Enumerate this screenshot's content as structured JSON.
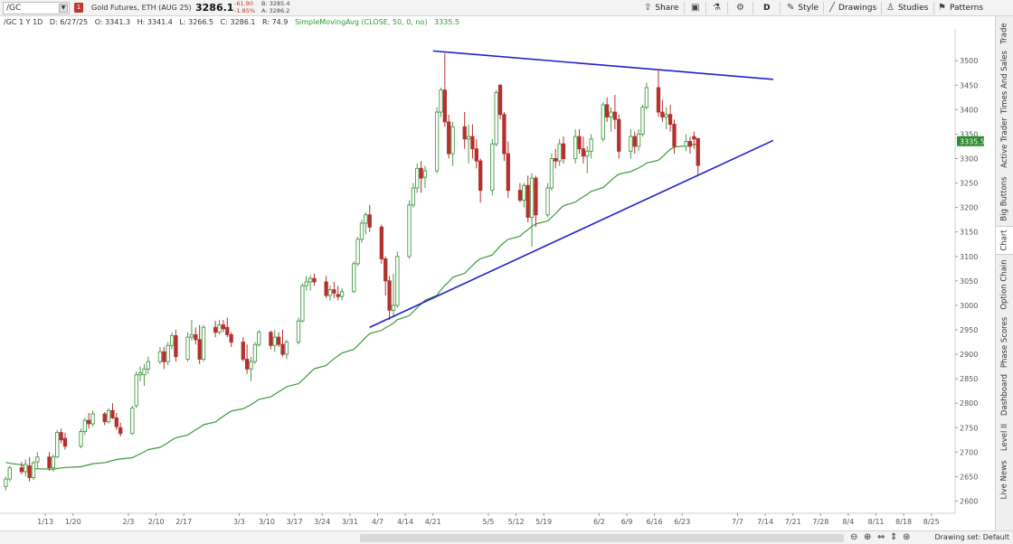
{
  "toolbar": {
    "symbol": "/GC",
    "alert_badge": "1",
    "instrument": "Gold Futures, ETH (AUG 25)",
    "last_price": "3286.1",
    "change": "-61.90",
    "change_pct": "-1.85%",
    "bid": "B: 3285.4",
    "ask": "A: 3286.2",
    "share_label": "Share",
    "timeframe_label": "D",
    "style_label": "Style",
    "drawings_label": "Drawings",
    "studies_label": "Studies",
    "patterns_label": "Patterns"
  },
  "infobar": {
    "period": "/GC 1 Y 1D",
    "date": "D: 6/27/25",
    "open": "O: 3341.3",
    "high": "H: 3341.4",
    "low": "L: 3266.5",
    "close": "C: 3286.1",
    "range": "R: 74.9",
    "sma_label": "SimpleMovingAvg (CLOSE, 50, 0, no)",
    "sma_value": "3335.5"
  },
  "right_tabs": [
    "Trade",
    "Times And Sales",
    "Active Trader",
    "Big Buttons",
    "Chart",
    "Option Chain",
    "Phase Scores",
    "Dashboard",
    "Level II",
    "Live News"
  ],
  "active_tab": "Chart",
  "bottombar": {
    "drawing_set": "Drawing set: Default"
  },
  "colors": {
    "up": "#4a9a4a",
    "down": "#b5312f",
    "sma": "#3a9a3a",
    "trendline": "#1f1fcf",
    "price_badge": "#2e8b2e"
  },
  "chart_data": {
    "type": "candlestick",
    "title": "",
    "y_ticks": [
      2600,
      2650,
      2700,
      2750,
      2800,
      2850,
      2900,
      2950,
      3000,
      3050,
      3100,
      3150,
      3200,
      3250,
      3300,
      3350,
      3400,
      3450,
      3500
    ],
    "ylim": [
      2575,
      3565
    ],
    "x_ticks": [
      "1/13",
      "1/20",
      "2/3",
      "2/10",
      "2/17",
      "3/3",
      "3/10",
      "3/17",
      "3/24",
      "3/31",
      "4/7",
      "4/14",
      "4/21",
      "5/5",
      "5/12",
      "5/19",
      "6/2",
      "6/9",
      "6/16",
      "6/23",
      "7/7",
      "7/14",
      "7/21",
      "7/28",
      "8/4",
      "8/11",
      "8/18",
      "8/25"
    ],
    "x_tick_days": [
      12,
      19,
      33,
      40,
      47,
      61,
      68,
      75,
      82,
      89,
      96,
      103,
      110,
      124,
      131,
      138,
      152,
      159,
      166,
      173,
      187,
      194,
      201,
      208,
      215,
      222,
      229,
      236
    ],
    "x_axis_note": "day index counted from 1/1",
    "xlim_days": [
      1,
      242
    ],
    "current_price": "3335.5",
    "current_price_value": 3335.5,
    "sma_period": 50,
    "sma_seed": [
      2680,
      2678,
      2675,
      2672,
      2669,
      2667,
      2666,
      2665,
      2664,
      2664
    ],
    "candles": [
      {
        "d": 2,
        "o": 2630,
        "h": 2650,
        "l": 2622,
        "c": 2645
      },
      {
        "d": 3,
        "o": 2645,
        "h": 2672,
        "l": 2640,
        "c": 2668
      },
      {
        "d": 6,
        "o": 2668,
        "h": 2680,
        "l": 2655,
        "c": 2660
      },
      {
        "d": 7,
        "o": 2660,
        "h": 2685,
        "l": 2650,
        "c": 2675
      },
      {
        "d": 8,
        "o": 2672,
        "h": 2690,
        "l": 2640,
        "c": 2648
      },
      {
        "d": 9,
        "o": 2648,
        "h": 2682,
        "l": 2643,
        "c": 2678
      },
      {
        "d": 10,
        "o": 2680,
        "h": 2700,
        "l": 2668,
        "c": 2690
      },
      {
        "d": 13,
        "o": 2690,
        "h": 2700,
        "l": 2662,
        "c": 2668
      },
      {
        "d": 14,
        "o": 2668,
        "h": 2695,
        "l": 2660,
        "c": 2690
      },
      {
        "d": 15,
        "o": 2690,
        "h": 2745,
        "l": 2688,
        "c": 2740
      },
      {
        "d": 16,
        "o": 2740,
        "h": 2748,
        "l": 2718,
        "c": 2725
      },
      {
        "d": 17,
        "o": 2728,
        "h": 2740,
        "l": 2705,
        "c": 2712
      },
      {
        "d": 21,
        "o": 2712,
        "h": 2748,
        "l": 2708,
        "c": 2742
      },
      {
        "d": 22,
        "o": 2742,
        "h": 2770,
        "l": 2735,
        "c": 2765
      },
      {
        "d": 23,
        "o": 2765,
        "h": 2780,
        "l": 2748,
        "c": 2758
      },
      {
        "d": 24,
        "o": 2758,
        "h": 2785,
        "l": 2752,
        "c": 2778
      },
      {
        "d": 27,
        "o": 2778,
        "h": 2782,
        "l": 2755,
        "c": 2762
      },
      {
        "d": 28,
        "o": 2762,
        "h": 2790,
        "l": 2758,
        "c": 2785
      },
      {
        "d": 29,
        "o": 2785,
        "h": 2800,
        "l": 2768,
        "c": 2770
      },
      {
        "d": 30,
        "o": 2770,
        "h": 2780,
        "l": 2745,
        "c": 2752
      },
      {
        "d": 31,
        "o": 2750,
        "h": 2760,
        "l": 2732,
        "c": 2738
      },
      {
        "d": 34,
        "o": 2738,
        "h": 2795,
        "l": 2735,
        "c": 2790
      },
      {
        "d": 35,
        "o": 2795,
        "h": 2865,
        "l": 2790,
        "c": 2858
      },
      {
        "d": 36,
        "o": 2858,
        "h": 2875,
        "l": 2845,
        "c": 2862
      },
      {
        "d": 37,
        "o": 2858,
        "h": 2880,
        "l": 2835,
        "c": 2870
      },
      {
        "d": 38,
        "o": 2870,
        "h": 2895,
        "l": 2860,
        "c": 2885
      },
      {
        "d": 41,
        "o": 2885,
        "h": 2915,
        "l": 2880,
        "c": 2905
      },
      {
        "d": 42,
        "o": 2905,
        "h": 2915,
        "l": 2870,
        "c": 2885
      },
      {
        "d": 43,
        "o": 2885,
        "h": 2925,
        "l": 2878,
        "c": 2918
      },
      {
        "d": 44,
        "o": 2918,
        "h": 2945,
        "l": 2910,
        "c": 2938
      },
      {
        "d": 45,
        "o": 2938,
        "h": 2950,
        "l": 2885,
        "c": 2895
      },
      {
        "d": 48,
        "o": 2890,
        "h": 2945,
        "l": 2885,
        "c": 2935
      },
      {
        "d": 49,
        "o": 2935,
        "h": 2970,
        "l": 2928,
        "c": 2940
      },
      {
        "d": 50,
        "o": 2940,
        "h": 2955,
        "l": 2920,
        "c": 2930
      },
      {
        "d": 51,
        "o": 2930,
        "h": 2960,
        "l": 2880,
        "c": 2890
      },
      {
        "d": 52,
        "o": 2890,
        "h": 2960,
        "l": 2885,
        "c": 2955
      },
      {
        "d": 55,
        "o": 2955,
        "h": 2968,
        "l": 2935,
        "c": 2945
      },
      {
        "d": 56,
        "o": 2945,
        "h": 2970,
        "l": 2940,
        "c": 2960
      },
      {
        "d": 57,
        "o": 2960,
        "h": 2970,
        "l": 2945,
        "c": 2952
      },
      {
        "d": 58,
        "o": 2955,
        "h": 2975,
        "l": 2935,
        "c": 2940
      },
      {
        "d": 59,
        "o": 2940,
        "h": 2945,
        "l": 2915,
        "c": 2925
      },
      {
        "d": 62,
        "o": 2925,
        "h": 2935,
        "l": 2885,
        "c": 2890
      },
      {
        "d": 63,
        "o": 2890,
        "h": 2920,
        "l": 2860,
        "c": 2870
      },
      {
        "d": 64,
        "o": 2870,
        "h": 2895,
        "l": 2845,
        "c": 2885
      },
      {
        "d": 65,
        "o": 2885,
        "h": 2925,
        "l": 2880,
        "c": 2920
      },
      {
        "d": 66,
        "o": 2920,
        "h": 2950,
        "l": 2915,
        "c": 2945
      },
      {
        "d": 69,
        "o": 2945,
        "h": 2948,
        "l": 2910,
        "c": 2918
      },
      {
        "d": 70,
        "o": 2918,
        "h": 2950,
        "l": 2905,
        "c": 2935
      },
      {
        "d": 71,
        "o": 2935,
        "h": 2945,
        "l": 2915,
        "c": 2920
      },
      {
        "d": 72,
        "o": 2920,
        "h": 2950,
        "l": 2895,
        "c": 2900
      },
      {
        "d": 73,
        "o": 2900,
        "h": 2930,
        "l": 2890,
        "c": 2925
      },
      {
        "d": 76,
        "o": 2925,
        "h": 2975,
        "l": 2920,
        "c": 2968
      },
      {
        "d": 77,
        "o": 2968,
        "h": 3045,
        "l": 2965,
        "c": 3040
      },
      {
        "d": 78,
        "o": 3040,
        "h": 3060,
        "l": 3030,
        "c": 3048
      },
      {
        "d": 79,
        "o": 3048,
        "h": 3062,
        "l": 3030,
        "c": 3055
      },
      {
        "d": 80,
        "o": 3055,
        "h": 3065,
        "l": 3040,
        "c": 3048
      },
      {
        "d": 83,
        "o": 3048,
        "h": 3060,
        "l": 3015,
        "c": 3020
      },
      {
        "d": 84,
        "o": 3020,
        "h": 3040,
        "l": 3010,
        "c": 3032
      },
      {
        "d": 85,
        "o": 3032,
        "h": 3048,
        "l": 3015,
        "c": 3025
      },
      {
        "d": 86,
        "o": 3022,
        "h": 3040,
        "l": 3010,
        "c": 3018
      },
      {
        "d": 87,
        "o": 3018,
        "h": 3035,
        "l": 3010,
        "c": 3028
      },
      {
        "d": 90,
        "o": 3028,
        "h": 3090,
        "l": 3025,
        "c": 3085
      },
      {
        "d": 91,
        "o": 3085,
        "h": 3140,
        "l": 3080,
        "c": 3135
      },
      {
        "d": 92,
        "o": 3135,
        "h": 3175,
        "l": 3128,
        "c": 3168
      },
      {
        "d": 93,
        "o": 3168,
        "h": 3190,
        "l": 3145,
        "c": 3185
      },
      {
        "d": 94,
        "o": 3185,
        "h": 3205,
        "l": 3150,
        "c": 3160
      },
      {
        "d": 97,
        "o": 3160,
        "h": 3165,
        "l": 3085,
        "c": 3095
      },
      {
        "d": 98,
        "o": 3095,
        "h": 3100,
        "l": 3020,
        "c": 3050
      },
      {
        "d": 99,
        "o": 3050,
        "h": 3060,
        "l": 2970,
        "c": 2990
      },
      {
        "d": 100,
        "o": 2990,
        "h": 3065,
        "l": 2975,
        "c": 3000
      },
      {
        "d": 101,
        "o": 3000,
        "h": 3110,
        "l": 2995,
        "c": 3100
      },
      {
        "d": 104,
        "o": 3100,
        "h": 3215,
        "l": 3095,
        "c": 3205
      },
      {
        "d": 105,
        "o": 3205,
        "h": 3250,
        "l": 3200,
        "c": 3240
      },
      {
        "d": 106,
        "o": 3240,
        "h": 3290,
        "l": 3230,
        "c": 3280
      },
      {
        "d": 107,
        "o": 3280,
        "h": 3295,
        "l": 3230,
        "c": 3260
      },
      {
        "d": 108,
        "o": 3262,
        "h": 3285,
        "l": 3240,
        "c": 3275
      },
      {
        "d": 111,
        "o": 3275,
        "h": 3405,
        "l": 3270,
        "c": 3395
      },
      {
        "d": 112,
        "o": 3395,
        "h": 3445,
        "l": 3385,
        "c": 3440
      },
      {
        "d": 113,
        "o": 3440,
        "h": 3515,
        "l": 3365,
        "c": 3375
      },
      {
        "d": 114,
        "o": 3375,
        "h": 3390,
        "l": 3300,
        "c": 3310
      },
      {
        "d": 115,
        "o": 3310,
        "h": 3375,
        "l": 3285,
        "c": 3365
      },
      {
        "d": 118,
        "o": 3365,
        "h": 3395,
        "l": 3320,
        "c": 3340
      },
      {
        "d": 119,
        "o": 3340,
        "h": 3370,
        "l": 3290,
        "c": 3345
      },
      {
        "d": 120,
        "o": 3345,
        "h": 3370,
        "l": 3300,
        "c": 3320
      },
      {
        "d": 121,
        "o": 3320,
        "h": 3340,
        "l": 3280,
        "c": 3295
      },
      {
        "d": 122,
        "o": 3295,
        "h": 3300,
        "l": 3210,
        "c": 3235
      },
      {
        "d": 125,
        "o": 3235,
        "h": 3340,
        "l": 3225,
        "c": 3330
      },
      {
        "d": 126,
        "o": 3330,
        "h": 3440,
        "l": 3325,
        "c": 3435
      },
      {
        "d": 127,
        "o": 3450,
        "h": 3452,
        "l": 3380,
        "c": 3390
      },
      {
        "d": 128,
        "o": 3390,
        "h": 3395,
        "l": 3295,
        "c": 3310
      },
      {
        "d": 129,
        "o": 3310,
        "h": 3335,
        "l": 3220,
        "c": 3235
      },
      {
        "d": 132,
        "o": 3235,
        "h": 3250,
        "l": 3210,
        "c": 3215
      },
      {
        "d": 133,
        "o": 3215,
        "h": 3250,
        "l": 3200,
        "c": 3245
      },
      {
        "d": 134,
        "o": 3245,
        "h": 3265,
        "l": 3170,
        "c": 3180
      },
      {
        "d": 135,
        "o": 3180,
        "h": 3270,
        "l": 3120,
        "c": 3260
      },
      {
        "d": 136,
        "o": 3260,
        "h": 3265,
        "l": 3160,
        "c": 3185
      },
      {
        "d": 139,
        "o": 3185,
        "h": 3250,
        "l": 3180,
        "c": 3240
      },
      {
        "d": 140,
        "o": 3240,
        "h": 3310,
        "l": 3235,
        "c": 3300
      },
      {
        "d": 141,
        "o": 3300,
        "h": 3320,
        "l": 3280,
        "c": 3295
      },
      {
        "d": 142,
        "o": 3295,
        "h": 3340,
        "l": 3285,
        "c": 3330
      },
      {
        "d": 143,
        "o": 3330,
        "h": 3345,
        "l": 3290,
        "c": 3300
      },
      {
        "d": 146,
        "o": 3300,
        "h": 3360,
        "l": 3290,
        "c": 3345
      },
      {
        "d": 147,
        "o": 3345,
        "h": 3360,
        "l": 3310,
        "c": 3320
      },
      {
        "d": 148,
        "o": 3320,
        "h": 3345,
        "l": 3290,
        "c": 3305
      },
      {
        "d": 149,
        "o": 3305,
        "h": 3325,
        "l": 3270,
        "c": 3315
      },
      {
        "d": 150,
        "o": 3315,
        "h": 3350,
        "l": 3300,
        "c": 3340
      },
      {
        "d": 153,
        "o": 3340,
        "h": 3415,
        "l": 3335,
        "c": 3410
      },
      {
        "d": 154,
        "o": 3410,
        "h": 3425,
        "l": 3375,
        "c": 3385
      },
      {
        "d": 155,
        "o": 3385,
        "h": 3405,
        "l": 3355,
        "c": 3395
      },
      {
        "d": 156,
        "o": 3395,
        "h": 3430,
        "l": 3360,
        "c": 3380
      },
      {
        "d": 157,
        "o": 3380,
        "h": 3390,
        "l": 3300,
        "c": 3315
      },
      {
        "d": 160,
        "o": 3315,
        "h": 3360,
        "l": 3300,
        "c": 3345
      },
      {
        "d": 161,
        "o": 3345,
        "h": 3355,
        "l": 3310,
        "c": 3325
      },
      {
        "d": 162,
        "o": 3325,
        "h": 3360,
        "l": 3315,
        "c": 3350
      },
      {
        "d": 163,
        "o": 3350,
        "h": 3410,
        "l": 3345,
        "c": 3405
      },
      {
        "d": 164,
        "o": 3405,
        "h": 3455,
        "l": 3400,
        "c": 3445
      },
      {
        "d": 167,
        "o": 3445,
        "h": 3480,
        "l": 3385,
        "c": 3395
      },
      {
        "d": 168,
        "o": 3395,
        "h": 3420,
        "l": 3375,
        "c": 3385
      },
      {
        "d": 169,
        "o": 3385,
        "h": 3405,
        "l": 3360,
        "c": 3390
      },
      {
        "d": 170,
        "o": 3390,
        "h": 3410,
        "l": 3355,
        "c": 3370
      },
      {
        "d": 171,
        "o": 3370,
        "h": 3380,
        "l": 3310,
        "c": 3325
      },
      {
        "d": 174,
        "o": 3325,
        "h": 3350,
        "l": 3315,
        "c": 3335
      },
      {
        "d": 175,
        "o": 3335,
        "h": 3345,
        "l": 3310,
        "c": 3325
      },
      {
        "d": 176,
        "o": 3345,
        "h": 3355,
        "l": 3320,
        "c": 3340
      },
      {
        "d": 177,
        "o": 3341,
        "h": 3341,
        "l": 3266,
        "c": 3286
      }
    ],
    "annotations": {
      "upper_trendline": [
        {
          "d": 110,
          "v": 3520
        },
        {
          "d": 196,
          "v": 3462
        }
      ],
      "lower_trendline": [
        {
          "d": 94,
          "v": 2955
        },
        {
          "d": 196,
          "v": 3337
        }
      ]
    }
  }
}
